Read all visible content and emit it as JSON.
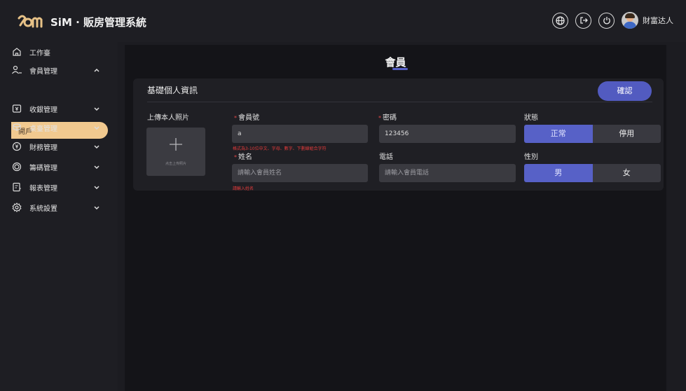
{
  "header": {
    "app_title": "SiM · 販房管理系統",
    "user_name": "財富达人"
  },
  "sidebar": {
    "items": [
      {
        "label": "工作臺",
        "icon": "home-icon"
      },
      {
        "label": "會員管理",
        "icon": "users-icon",
        "expanded": true
      },
      {
        "label": "收銀管理",
        "icon": "cashier-icon"
      },
      {
        "label": "桌臺管理",
        "icon": "table-icon"
      },
      {
        "label": "財務管理",
        "icon": "finance-icon"
      },
      {
        "label": "籌碼管理",
        "icon": "chip-icon"
      },
      {
        "label": "報表管理",
        "icon": "report-icon"
      },
      {
        "label": "系統設置",
        "icon": "settings-icon"
      }
    ],
    "sub_item": {
      "label": "開戶",
      "accent": "#f1c98f"
    }
  },
  "main": {
    "page_title": "會員",
    "card_title": "基礎個人資訊",
    "confirm_label": "確認",
    "upload": {
      "label": "上傳本人照片",
      "hint": "点击上传照片"
    },
    "member_no": {
      "label": "會員號",
      "value": "a",
      "error": "格式為3-10位中文、字母、數字、下劃線組合字符"
    },
    "password": {
      "label": "密碼",
      "value": "123456"
    },
    "status": {
      "label": "狀態",
      "options": [
        "正常",
        "停用"
      ],
      "selected": "正常"
    },
    "name": {
      "label": "姓名",
      "placeholder": "請輸入會員姓名",
      "error": "請輸入姓名"
    },
    "phone": {
      "label": "電話",
      "placeholder": "請輸入會員電話"
    },
    "gender": {
      "label": "性別",
      "options": [
        "男",
        "女"
      ],
      "selected": "男"
    },
    "colors": {
      "accent": "#5761c7",
      "error": "#e04848"
    }
  }
}
